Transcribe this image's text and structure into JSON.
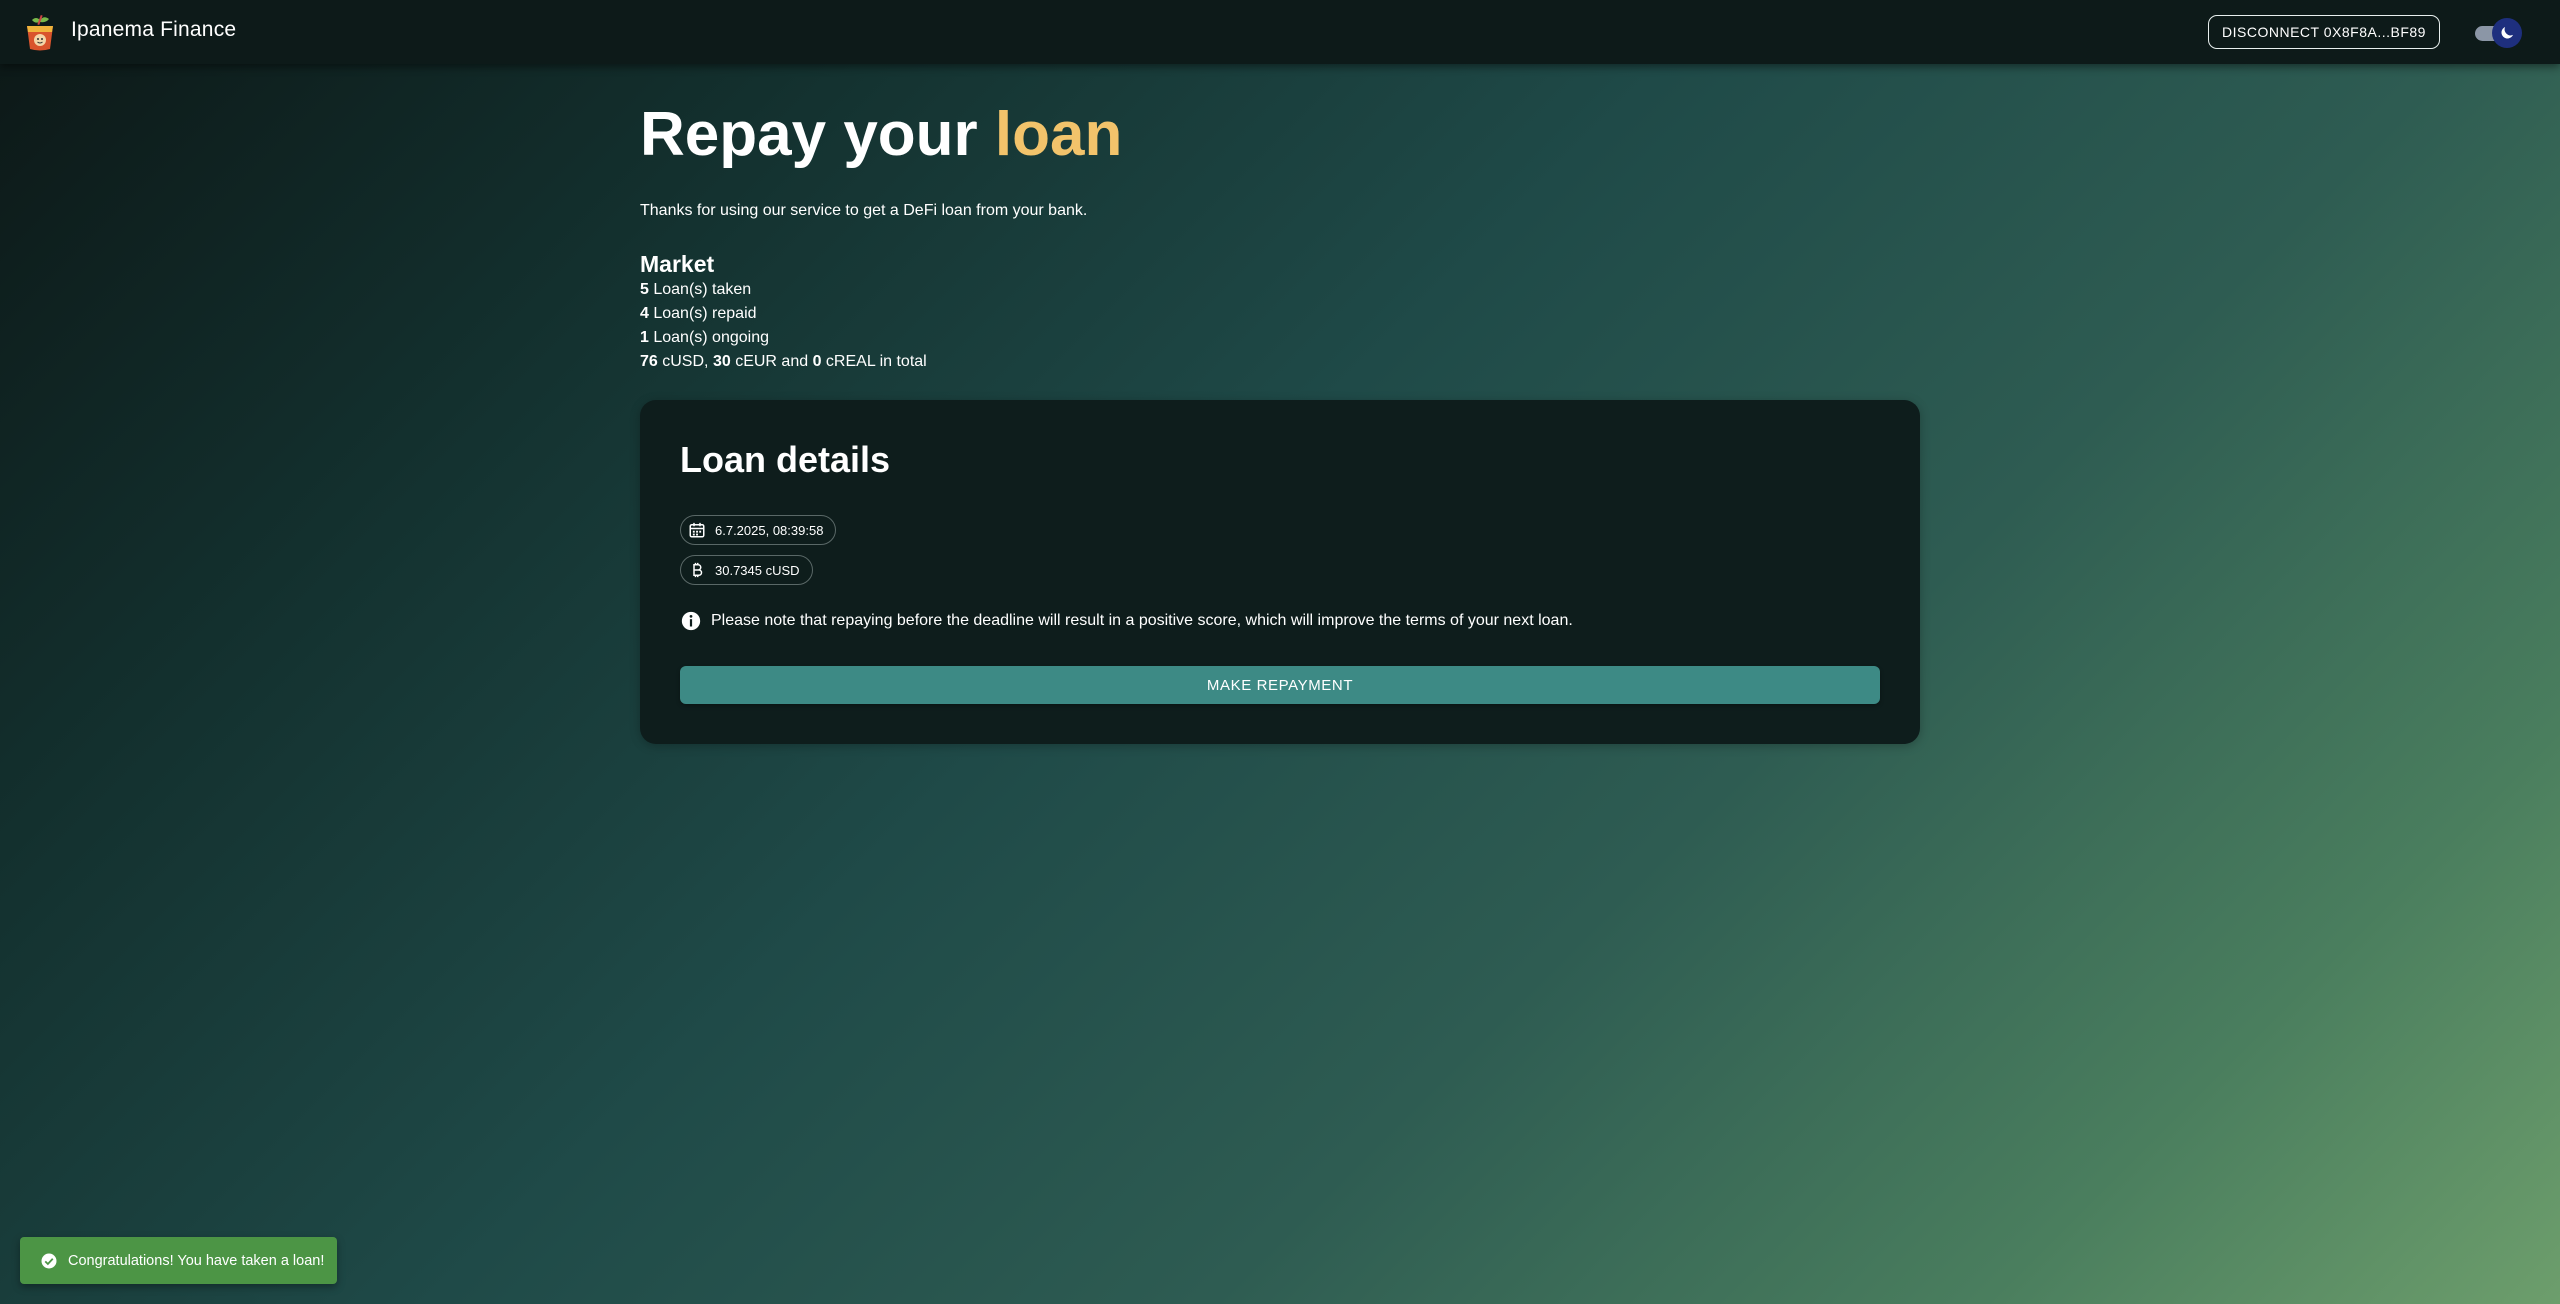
{
  "header": {
    "app_name": "Ipanema Finance",
    "logo_icon": "cocktail-logo-icon",
    "disconnect_label": "DISCONNECT 0X8F8A...BF89",
    "theme_toggle_icon": "moon-icon"
  },
  "hero": {
    "title_main": "Repay your",
    "title_accent": "loan",
    "accent_color": "#f2c36b",
    "intro": "Thanks for using our service to get a DeFi loan from your bank."
  },
  "market": {
    "title": "Market",
    "taken_count": "5",
    "taken_label": "Loan(s) taken",
    "repaid_count": "4",
    "repaid_label": "Loan(s) repaid",
    "ongoing_count": "1",
    "ongoing_label": "Loan(s) ongoing",
    "total": {
      "cusd_amount": "76",
      "cusd_label": "cUSD,",
      "ceur_amount": "30",
      "ceur_label": "cEUR and",
      "creal_amount": "0",
      "creal_label": "cREAL in total"
    }
  },
  "loan_details": {
    "title": "Loan details",
    "date": "6.7.2025, 08:39:58",
    "amount": "30.7345 cUSD",
    "notice": "Please note that repaying before the deadline will result in a positive score, which will improve the terms of your next loan.",
    "repay_button": "MAKE REPAYMENT",
    "button_color": "#3d8a85"
  },
  "snackbar": {
    "message": "Congratulations! You have taken a loan!",
    "color": "#4c9545"
  }
}
